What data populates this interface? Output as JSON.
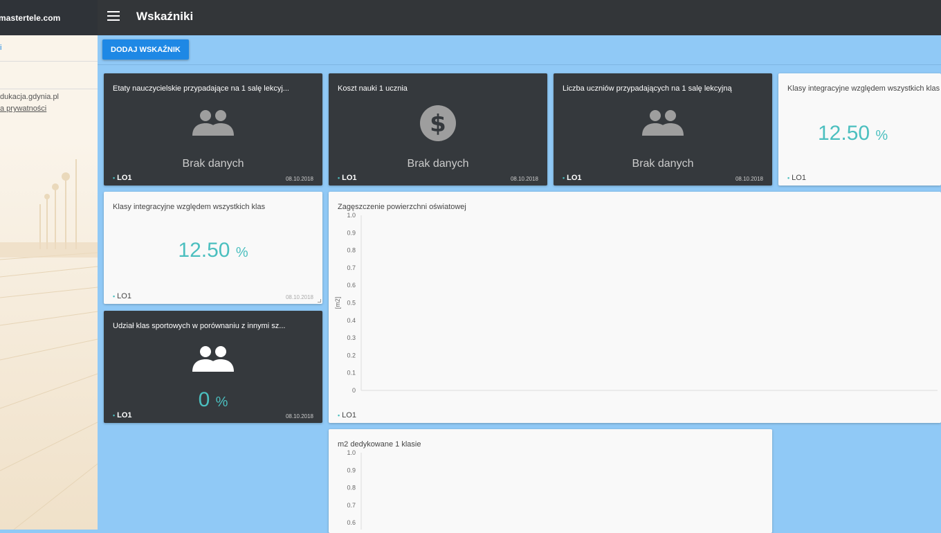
{
  "sidebar": {
    "brand": "mastertele.com",
    "link": "i",
    "footer_line1": "dukacja.gdynia.pl",
    "footer_line2": "a prywatności"
  },
  "header": {
    "title": "Wskaźniki",
    "menu_icon": "hamburger-menu-icon"
  },
  "toolbar": {
    "add_label": "DODAJ WSKAŹNIK"
  },
  "colors": {
    "accent": "#1e88e5",
    "teal": "#4bbfbf",
    "dark_card": "#35393d",
    "background": "#90c9f6",
    "topbar": "#333639"
  },
  "cards": [
    {
      "title": "Etaty nauczycielskie przypadające na 1 salę lekcyj...",
      "icon": "people-icon",
      "status": "Brak danych",
      "tag": "LO1",
      "date": "08.10.2018"
    },
    {
      "title": "Koszt nauki 1 ucznia",
      "icon": "dollar-icon",
      "status": "Brak danych",
      "tag": "LO1",
      "date": "08.10.2018"
    },
    {
      "title": "Liczba uczniów przypadających na 1 salę lekcyjną",
      "icon": "people-icon",
      "status": "Brak danych",
      "tag": "LO1",
      "date": "08.10.2018"
    },
    {
      "title": "Klasy integracyjne względem wszystkich klas",
      "value": "12.50",
      "unit": "%",
      "tag": "LO1"
    },
    {
      "title": "Klasy integracyjne względem wszystkich klas",
      "value": "12.50",
      "unit": "%",
      "tag": "LO1",
      "date": "08.10.2018"
    },
    {
      "title": "Udział klas sportowych w porównaniu z innymi sz...",
      "icon": "people-icon",
      "value": "0",
      "unit": "%",
      "tag": "LO1",
      "date": "08.10.2018"
    }
  ],
  "chart_data": [
    {
      "type": "line",
      "title": "Zagęszczenie powierzchni oświatowej",
      "ylabel": "[m2]",
      "ylim": [
        0,
        1
      ],
      "yticks": [
        "1.0",
        "0.9",
        "0.8",
        "0.7",
        "0.6",
        "0.5",
        "0.4",
        "0.3",
        "0.2",
        "0.1",
        "0"
      ],
      "series": [],
      "legend": "LO1"
    },
    {
      "type": "line",
      "title": "m2 dedykowane 1 klasie",
      "ylim": [
        0,
        1
      ],
      "yticks": [
        "1.0",
        "0.9",
        "0.8",
        "0.7",
        "0.6"
      ],
      "series": []
    }
  ]
}
